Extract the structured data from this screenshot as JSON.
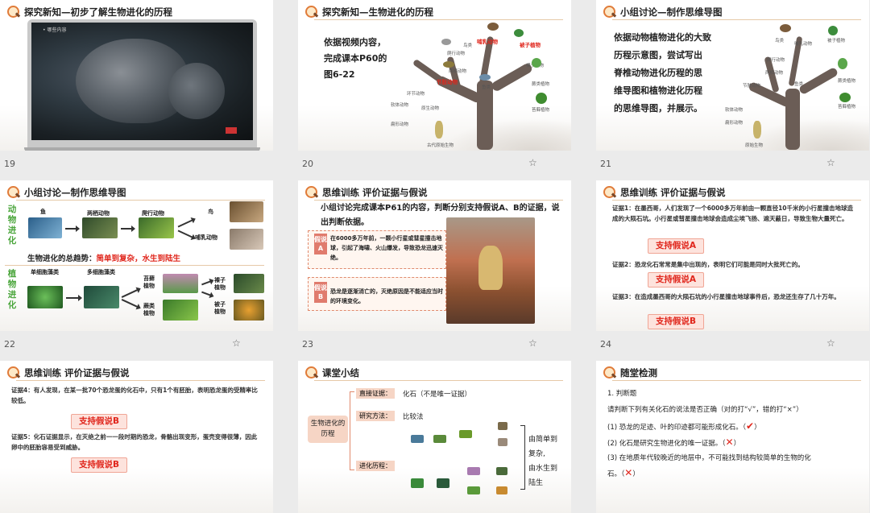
{
  "slides": [
    {
      "num": "19",
      "title": "探究新知—初步了解生物进化的历程",
      "video_caption": "• 哪些内容"
    },
    {
      "num": "20",
      "title": "探究新知—生物进化的历程",
      "body": [
        "依据视频内容，",
        "完成课本P60的",
        "图6-22"
      ],
      "tree_red_labels": [
        "哺乳动物",
        "被子植物",
        "节肢动物"
      ],
      "tree_labels": [
        "鸟类",
        "爬行动物",
        "两栖动物",
        "鱼类",
        "环节动物",
        "软体动物",
        "扁形动物",
        "线形动物",
        "腔肠动物",
        "原生动物",
        "裸子植物",
        "蕨类植物",
        "苔藓植物",
        "藻类植物",
        "古代原始生物"
      ]
    },
    {
      "num": "21",
      "title": "小组讨论—制作思维导图",
      "body": [
        "依据动物植物进化的大致",
        "历程示意图，尝试写出",
        "脊椎动物进化历程的思",
        "维导图和植物进化历程",
        "的思维导图，并展示。"
      ],
      "tree_labels": [
        "鸟类",
        "哺乳动物",
        "被子植物",
        "爬行动物",
        "两栖动物",
        "鱼类",
        "节肢动物",
        "软体动物",
        "环节动物",
        "扁形动物",
        "线形动物",
        "蕨类植物",
        "苔藓植物",
        "藻类植物",
        "原始生物"
      ]
    },
    {
      "num": "22",
      "title": "小组讨论—制作思维导图",
      "animal_side": "动物进化",
      "plant_side": "植物进化",
      "animals": [
        "鱼",
        "两栖动物",
        "爬行动物",
        "鸟",
        "哺乳动物"
      ],
      "trend": "生物进化的总趋势：简单到复杂，水生到陆生",
      "trend_prefix": "生物进化的总趋势：",
      "trend_highlight": "简单到复杂，水生到陆生",
      "plants": [
        "单细胞藻类",
        "多细胞藻类",
        "苔藓植物",
        "蕨类植物",
        "裸子植物",
        "被子植物"
      ]
    },
    {
      "num": "23",
      "title": "思维训练  评价证据与假说",
      "body": "小组讨论完成课本P61的内容，判断分别支持假说A、B的证据，说出判断依据。",
      "hypoA_label": "假说A",
      "hypoA": "在6000多万年前，一颗小行星或彗星撞击地球，引起了海啸、火山爆发，导致恐龙迅速灭绝。",
      "hypoB_label": "假说B",
      "hypoB": "恐龙是逐渐消亡的，灭绝原因是不能适应当时的环境变化。"
    },
    {
      "num": "24",
      "title": "思维训练  评价证据与假说",
      "ev1": "证据1：在墨西哥，人们发现了一个6000多万年前由一颗直径10千米的小行星撞击地球造成的大陨石坑。小行星或彗星撞击地球会造成尘埃飞扬、遮天蔽日，导致生物大量死亡。",
      "btn1": "支持假说A",
      "ev2": "证据2：恐龙化石常常是集中出现的，表明它们可能是同时大批死亡的。",
      "btn2": "支持假说A",
      "ev3": "证据3：在造成墨西哥的大陨石坑的小行星撞击地球事件后，恐龙还生存了几十万年。",
      "btn3": "支持假说B"
    },
    {
      "num": "25",
      "title": "思维训练  评价证据与假说",
      "ev4": "证据4：有人发现，在某一批70个恐龙蛋的化石中，只有1个有胚胎，表明恐龙蛋的受精率比较低。",
      "btn4": "支持假说B",
      "ev5": "证据5：化石证据显示，在灭绝之前一一段时期的恐龙，骨骼出现变形，蛋壳变得很薄，因此卵中的胚胎容易受到威胁。",
      "btn5": "支持假说B"
    },
    {
      "num": "26",
      "title": "课堂小结",
      "center": "生物进化的历程",
      "direct_label": "直接证据：",
      "direct_value": "化石（不是唯一证据）",
      "method_label": "研究方法：",
      "method_value": "比较法",
      "process_label": "进化历程：",
      "right_text": [
        "由简单到",
        "复杂,",
        "由水生到",
        "陆生"
      ]
    },
    {
      "num": "27",
      "title": "随堂检测",
      "lines": [
        "1. 判断题",
        "请判断下列有关化石的说法是否正确（对的打“√”，错的打“×”）",
        "(1) 恐龙的足迹、叶的印迹都可能形成化石。（",
        "(2) 化石是研究生物进化的唯一证据。（",
        "(3) 在地质年代较晚近的地层中，不可能找到结构较简单的生物的化",
        "石。（"
      ],
      "marks": [
        "✔",
        "✕",
        "✕"
      ],
      "close_paren": "）"
    }
  ],
  "colors": {
    "accent_red": "#e0251b",
    "green": "#4aa53b",
    "border": "#e6c9a8"
  }
}
